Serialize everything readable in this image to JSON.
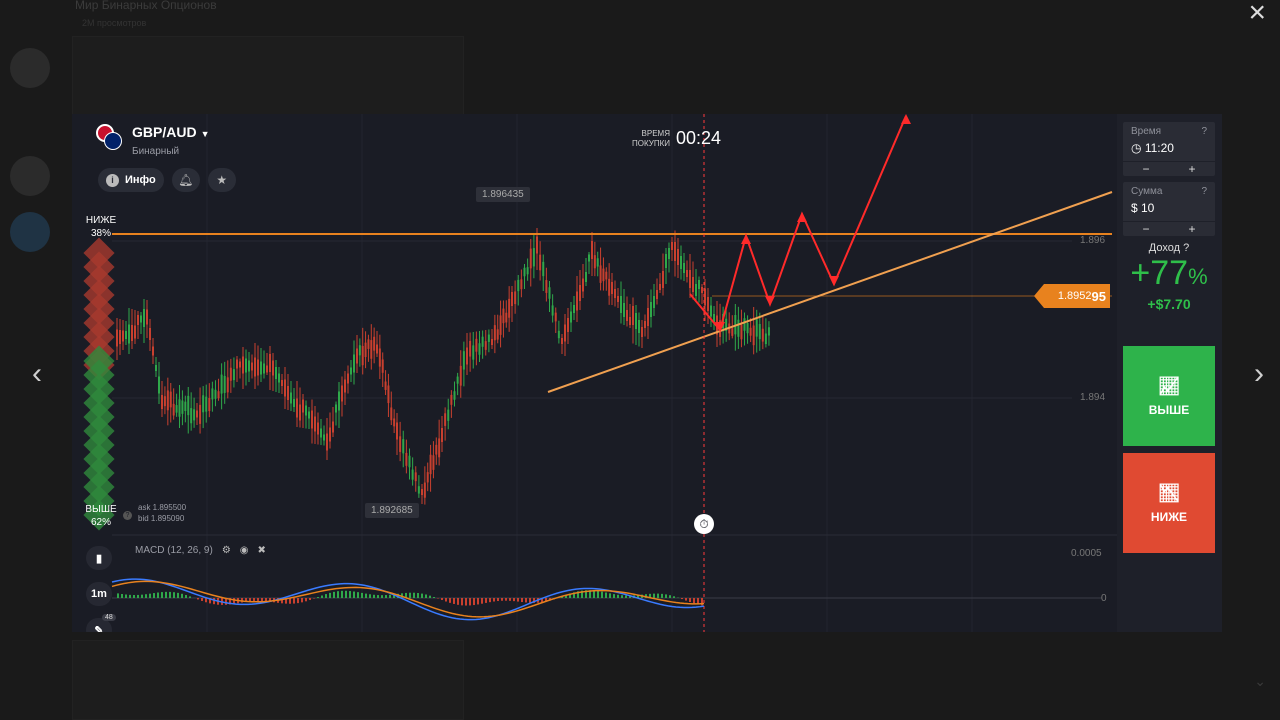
{
  "background": {
    "title": "Мир Бинарных Опционов",
    "subtitle": "2M просмотров"
  },
  "asset": {
    "name": "GBP/AUD",
    "type": "Бинарный"
  },
  "toolbar": {
    "info_label": "Инфо"
  },
  "timer": {
    "label_line1": "ВРЕМЯ",
    "label_line2": "ПОКУПКИ",
    "value": "00:24"
  },
  "sentiment": {
    "lower_label": "НИЖЕ",
    "lower_pct": "38%",
    "higher_label": "ВЫШЕ",
    "higher_pct": "62%"
  },
  "quotes": {
    "ask": "ask 1.895500",
    "bid": "bid 1.895090"
  },
  "chart": {
    "high_label": "1.896435",
    "low_label": "1.892685",
    "axis_high": "1.896",
    "axis_low": "1.894",
    "current_price_prefix": "1.8952",
    "current_price_suffix": "95",
    "macd_axis_top": "0.0005",
    "macd_axis_zero": "0"
  },
  "macd": {
    "label": "MACD (12, 26, 9)"
  },
  "side_buttons": {
    "timeframe": "1m",
    "drawings_count": "48"
  },
  "panel": {
    "time_label": "Время",
    "time_value": "11:20",
    "amount_label": "Сумма",
    "amount_value": "$ 10",
    "minus": "−",
    "plus": "+",
    "income_label": "Доход",
    "income_pct": "+77",
    "income_pct_sign": "%",
    "income_usd": "+$7.70"
  },
  "buttons": {
    "up": "ВЫШЕ",
    "down": "НИЖЕ"
  },
  "colors": {
    "up": "#2eb34b",
    "down": "#e04a32",
    "accent": "#e8821e",
    "annotation": "#ff2a2a"
  }
}
